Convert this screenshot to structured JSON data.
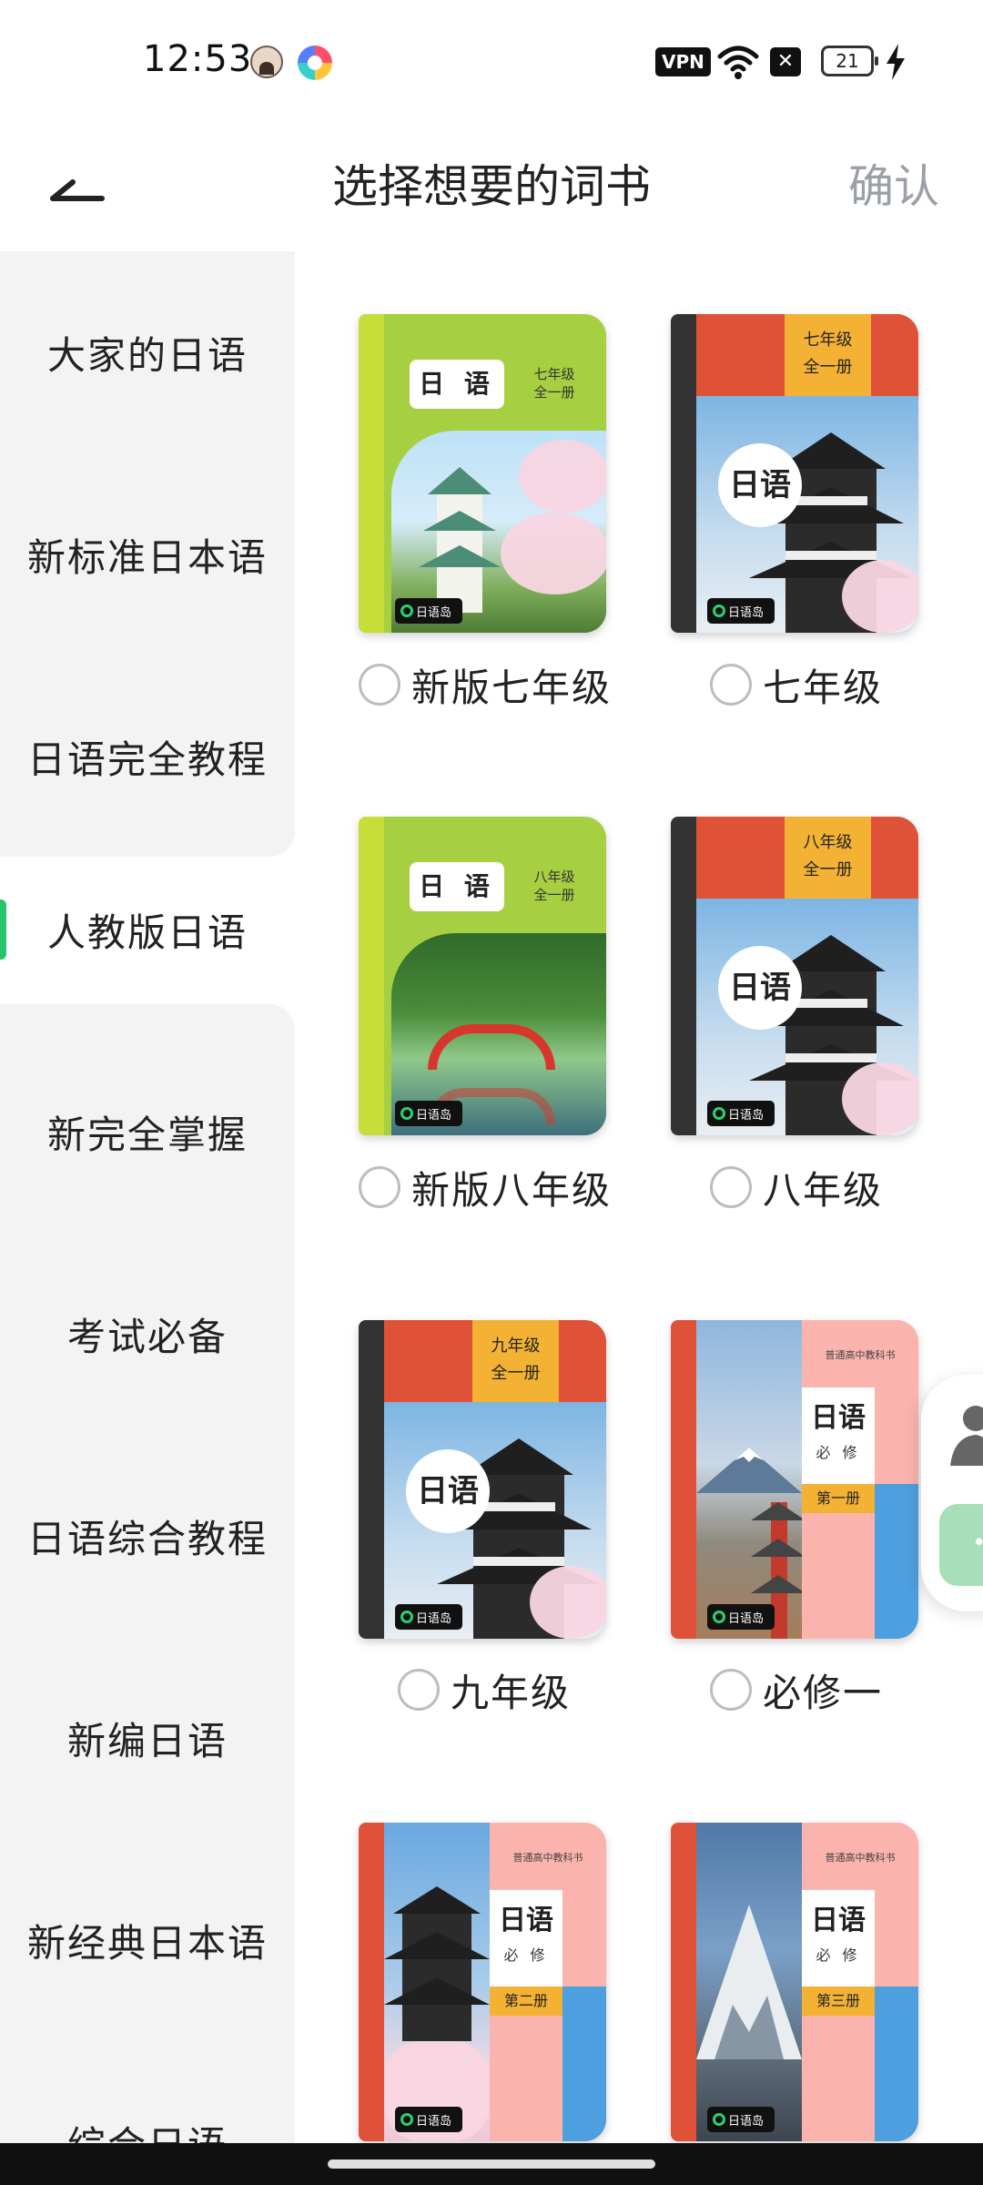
{
  "status_bar": {
    "time": "12:53",
    "vpn_label": "VPN",
    "battery_level": "21",
    "icons": [
      "avatar-icon",
      "pinwheel-icon",
      "wifi-icon",
      "close-icon",
      "battery-icon",
      "charging-bolt-icon"
    ]
  },
  "header": {
    "title": "选择想要的词书",
    "confirm_label": "确认",
    "back_icon": "back-arrow-icon"
  },
  "sidebar": {
    "items": [
      {
        "label": "大家的日语"
      },
      {
        "label": "新标准日本语"
      },
      {
        "label": "日语完全教程"
      },
      {
        "label": "人教版日语",
        "active": true
      },
      {
        "label": "新完全掌握"
      },
      {
        "label": "考试必备"
      },
      {
        "label": "日语综合教程"
      },
      {
        "label": "新编日语"
      },
      {
        "label": "新经典日本语"
      },
      {
        "label": "综合日语"
      }
    ],
    "accent_color": "#27c46e"
  },
  "books": [
    {
      "label": "新版七年级",
      "cover": {
        "title": "日 语",
        "grade": "七年级",
        "volume": "全一册",
        "logo": "日语岛"
      }
    },
    {
      "label": "七年级",
      "cover": {
        "title": "日语",
        "grade": "七年级",
        "volume": "全一册",
        "logo": "日语岛"
      }
    },
    {
      "label": "新版八年级",
      "cover": {
        "title": "日 语",
        "grade": "八年级",
        "volume": "全一册",
        "logo": "日语岛"
      }
    },
    {
      "label": "八年级",
      "cover": {
        "title": "日语",
        "grade": "八年级",
        "volume": "全一册",
        "logo": "日语岛"
      }
    },
    {
      "label": "九年级",
      "cover": {
        "title": "日语",
        "grade": "九年级",
        "volume": "全一册",
        "logo": "日语岛"
      }
    },
    {
      "label": "必修一",
      "cover": {
        "series": "普通高中教科书",
        "title": "日语",
        "subtitle": "必 修",
        "volume": "第一册",
        "logo": "日语岛"
      }
    },
    {
      "cover": {
        "series": "普通高中教科书",
        "title": "日语",
        "subtitle": "必 修",
        "volume": "第二册",
        "logo": "日语岛"
      }
    },
    {
      "cover": {
        "series": "普通高中教科书",
        "title": "日语",
        "subtitle": "必 修",
        "volume": "第三册",
        "logo": "日语岛"
      }
    }
  ]
}
